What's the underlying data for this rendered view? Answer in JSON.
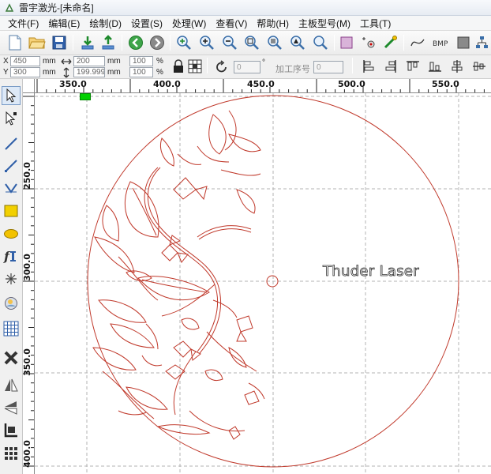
{
  "window": {
    "title": "雷宇激光-[未命名]"
  },
  "menu": [
    "文件(F)",
    "编辑(E)",
    "绘制(D)",
    "设置(S)",
    "处理(W)",
    "查看(V)",
    "帮助(H)",
    "主板型号(M)",
    "工具(T)"
  ],
  "toolbar": {
    "icons": [
      "new-file-icon",
      "open-folder-icon",
      "save-icon",
      "import-icon",
      "export-icon",
      "back-icon",
      "forward-icon",
      "zoom-in-icon",
      "zoom-plus-icon",
      "zoom-minus-icon",
      "zoom-page-icon",
      "zoom-all-icon",
      "zoom-fit-icon",
      "zoom-select-icon",
      "rectangle-select-icon",
      "node-edit-icon",
      "smooth-icon",
      "curve-icon",
      "bitmap-icon",
      "frame-icon",
      "tree-icon"
    ]
  },
  "properties": {
    "x_label": "X",
    "x_value": "450",
    "y_label": "Y",
    "y_value": "300",
    "unit": "mm",
    "width_value": "200",
    "height_value": "199.999",
    "scale_x": "100",
    "scale_y": "100",
    "percent": "%",
    "rotation_value": "0",
    "degree_symbol": "°",
    "process_order_label": "加工序号",
    "process_order_value": "0"
  },
  "left_tools": [
    "select-arrow-icon",
    "node-select-icon",
    "line-icon",
    "polyline-icon",
    "curve-tool-icon",
    "rectangle-tool-icon",
    "ellipse-tool-icon",
    "text-tool-icon",
    "dot-array-icon",
    "bitmap-import-icon",
    "grid-array-icon",
    "delete-cross-icon",
    "mirror-h-icon",
    "mirror-v-icon",
    "align-icon",
    "array-copy-icon"
  ],
  "ruler": {
    "top_labels": [
      "350.0",
      "400.0",
      "450.0",
      "500.0",
      "550.0"
    ],
    "left_labels": [
      "250.0",
      "300.0",
      "350.0",
      "400.0"
    ]
  },
  "canvas": {
    "text": "Thuder Laser",
    "line_color": "#c0392b",
    "grid_color": "#b0b0b0"
  }
}
